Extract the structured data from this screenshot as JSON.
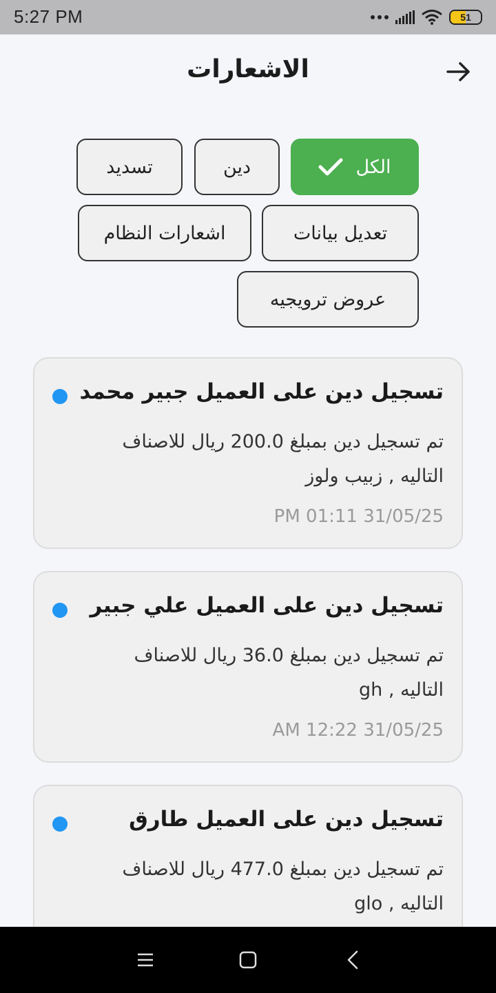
{
  "status_bar": {
    "time": "5:27  PM",
    "battery": "51",
    "battery_fraction": 0.51,
    "icons": [
      "more-dots-icon",
      "signal-icon",
      "wifi-icon",
      "battery-icon"
    ]
  },
  "header": {
    "title": "الاشعارات",
    "back_icon": "arrow-right-icon"
  },
  "filters": {
    "active_color": "#4caf50",
    "chips": [
      {
        "label": "الكل",
        "selected": true,
        "icon": "check-icon"
      },
      {
        "label": "دين",
        "selected": false
      },
      {
        "label": "تسديد",
        "selected": false
      },
      {
        "label": "تعديل بيانات",
        "selected": false
      },
      {
        "label": "اشعارات النظام",
        "selected": false
      },
      {
        "label": "عروض ترويجيه",
        "selected": false
      }
    ]
  },
  "notifications": {
    "unread_color": "#2196f3",
    "items": [
      {
        "title": "تسجيل دين على العميل جبير محمد",
        "body": "تم تسجيل دين بمبلغ 200.0 ريال للاصناف التاليه , زبيب ولوز",
        "time": "PM 01:11 31/05/25",
        "unread": true
      },
      {
        "title": "تسجيل دين على العميل علي جبير",
        "body": "تم تسجيل دين بمبلغ 36.0 ريال للاصناف التاليه , gh",
        "time": "AM 12:22 31/05/25",
        "unread": true
      },
      {
        "title": "تسجيل دين على العميل طارق",
        "body": "تم تسجيل دين بمبلغ 477.0 ريال للاصناف التاليه , glo",
        "time": "",
        "unread": true
      }
    ]
  },
  "nav_bar": {
    "icons": [
      "menu-icon",
      "home-icon",
      "back-icon"
    ]
  }
}
